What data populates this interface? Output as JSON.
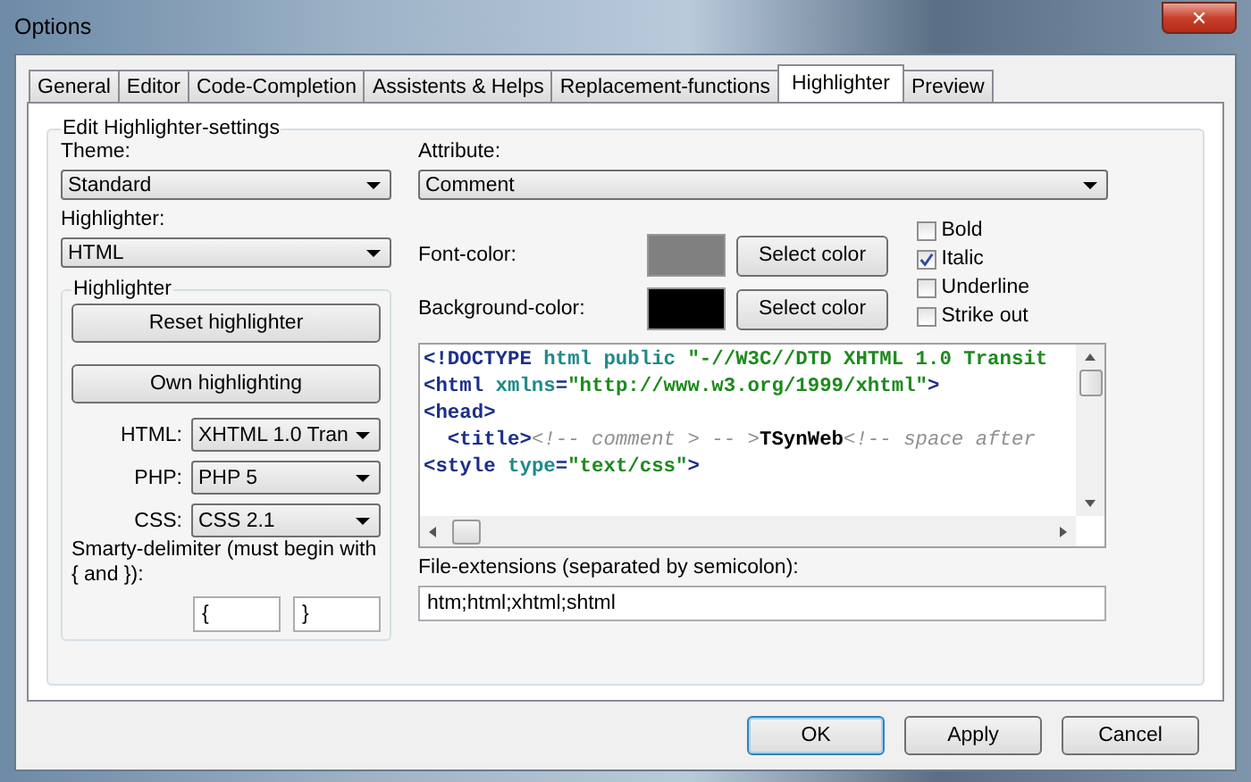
{
  "window": {
    "title": "Options",
    "close": "✕"
  },
  "tabs": [
    {
      "label": "General",
      "selected": false
    },
    {
      "label": "Editor",
      "selected": false
    },
    {
      "label": "Code-Completion",
      "selected": false
    },
    {
      "label": "Assistents & Helps",
      "selected": false
    },
    {
      "label": "Replacement-functions",
      "selected": false
    },
    {
      "label": "Highlighter",
      "selected": true
    },
    {
      "label": "Preview",
      "selected": false
    }
  ],
  "group": {
    "title": "Edit Highlighter-settings"
  },
  "theme": {
    "label": "Theme:",
    "value": "Standard"
  },
  "highlighter": {
    "label": "Highlighter:",
    "value": "HTML"
  },
  "highlighter_group": {
    "title": "Highlighter",
    "buttons": [
      "Reset highlighter",
      "Own highlighting"
    ],
    "selects": [
      {
        "label": "HTML:",
        "value": "XHTML 1.0 Tran"
      },
      {
        "label": "PHP:",
        "value": "PHP 5"
      },
      {
        "label": "CSS:",
        "value": "CSS 2.1"
      }
    ],
    "smarty_label": "Smarty-delimiter (must begin with { and }):",
    "smarty_open": "{",
    "smarty_close": "}"
  },
  "attribute": {
    "label": "Attribute:",
    "value": "Comment"
  },
  "colors": [
    {
      "label": "Font-color:",
      "color": "#808080",
      "button": "Select color"
    },
    {
      "label": "Background-color:",
      "color": "#000000",
      "button": "Select color"
    }
  ],
  "styles": [
    {
      "label": "Bold",
      "checked": false
    },
    {
      "label": "Italic",
      "checked": true
    },
    {
      "label": "Underline",
      "checked": false
    },
    {
      "label": "Strike out",
      "checked": false
    }
  ],
  "preview_lines": [
    [
      {
        "kind": "tag",
        "text": "<!DOCTYPE"
      },
      {
        "kind": "attr",
        "text": " html public "
      },
      {
        "kind": "value",
        "text": "\"-//W3C//DTD XHTML 1.0 Transit"
      }
    ],
    [
      {
        "kind": "tag",
        "text": "<html"
      },
      {
        "kind": "attr",
        "text": " xmlns"
      },
      {
        "kind": "tag",
        "text": "="
      },
      {
        "kind": "value",
        "text": "\"http://www.w3.org/1999/xhtml\""
      },
      {
        "kind": "tag",
        "text": ">"
      }
    ],
    [
      {
        "kind": "tag",
        "text": "<head>"
      }
    ],
    [
      {
        "kind": "tag",
        "text": "  <title>"
      },
      {
        "kind": "comment",
        "text": "<!-- comment > -- >"
      },
      {
        "kind": "text",
        "text": "TSynWeb"
      },
      {
        "kind": "comment",
        "text": "<!-- space after"
      }
    ],
    [
      {
        "kind": "tag",
        "text": "<style"
      },
      {
        "kind": "attr",
        "text": " type"
      },
      {
        "kind": "tag",
        "text": "="
      },
      {
        "kind": "value",
        "text": "\"text/css\""
      },
      {
        "kind": "tag",
        "text": ">"
      }
    ]
  ],
  "extensions": {
    "label": "File-extensions (separated by semicolon):",
    "value": "htm;html;xhtml;shtml"
  },
  "buttons": [
    {
      "label": "OK",
      "default": true
    },
    {
      "label": "Apply",
      "default": false
    },
    {
      "label": "Cancel",
      "default": false
    }
  ]
}
